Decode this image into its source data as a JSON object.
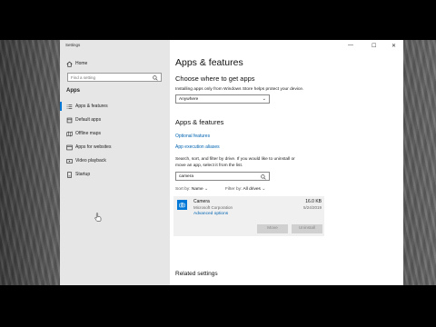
{
  "window": {
    "title": "Settings",
    "controls": {
      "minimize": "—",
      "maximize": "☐",
      "close": "✕"
    }
  },
  "sidebar": {
    "home_label": "Home",
    "search_placeholder": "Find a setting",
    "section_label": "Apps",
    "items": [
      {
        "label": "Apps & features",
        "icon": "list-icon",
        "selected": true
      },
      {
        "label": "Default apps",
        "icon": "default-apps-icon"
      },
      {
        "label": "Offline maps",
        "icon": "map-icon"
      },
      {
        "label": "Apps for websites",
        "icon": "website-icon"
      },
      {
        "label": "Video playback",
        "icon": "video-icon"
      },
      {
        "label": "Startup",
        "icon": "startup-icon"
      }
    ]
  },
  "main": {
    "page_title": "Apps & features",
    "choose_heading": "Choose where to get apps",
    "choose_desc": "Installing apps only from Windows Store helps protect your device.",
    "source_dropdown_value": "Anywhere",
    "apps_heading": "Apps & features",
    "link_optional": "Optional features",
    "link_aliases": "App execution aliases",
    "filter_desc_line1": "Search, sort, and filter by drive. If you would like to uninstall or",
    "filter_desc_line2": "move an app, select it from the list.",
    "search_value": "camera",
    "sort_label": "Sort by:",
    "sort_value": "Name",
    "filter_label": "Filter by:",
    "filter_value": "All drives",
    "app": {
      "name": "Camera",
      "publisher": "Microsoft Corporation",
      "advanced": "Advanced options",
      "size": "16.0 KB",
      "date": "5/24/2019",
      "move_button": "Move",
      "uninstall_button": "Uninstall"
    },
    "related_heading": "Related settings"
  },
  "colors": {
    "accent": "#0078d7",
    "link": "#0063b1",
    "sidebar_bg": "#e6e6e6"
  }
}
